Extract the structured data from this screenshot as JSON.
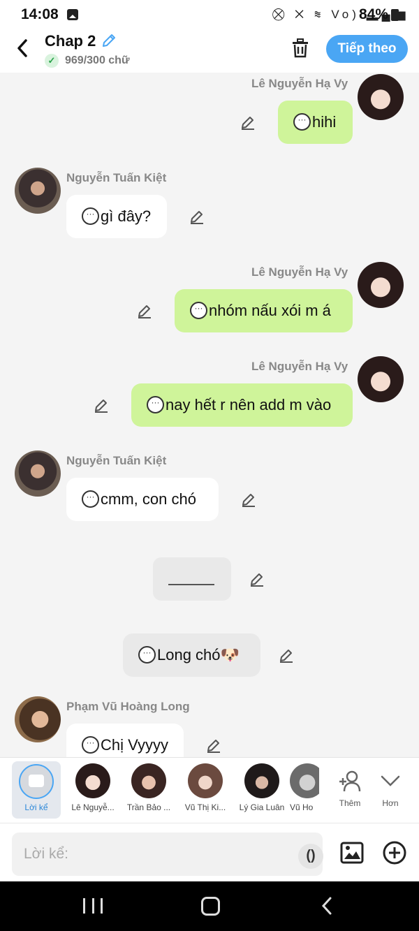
{
  "status_bar": {
    "time": "14:08",
    "network_icons": "⛒ ✕ ≋ Vo) ▂▄▆",
    "battery": "84%"
  },
  "header": {
    "title": "Chap 2",
    "word_count": "969/300 chữ",
    "next_label": "Tiếp theo"
  },
  "messages": [
    {
      "sender": "Lê Nguyễn Hạ Vy",
      "text": "hihi"
    },
    {
      "sender": "Nguyễn Tuấn Kiệt",
      "text": "gì đây?"
    },
    {
      "sender": "Lê Nguyễn Hạ Vy",
      "text": "nhóm nấu xói m á"
    },
    {
      "sender": "Lê Nguyễn Hạ Vy",
      "text": "nay hết r nên add m vào"
    },
    {
      "sender": "Nguyễn Tuấn Kiệt",
      "text": "cmm, con chó"
    },
    {
      "sender": "",
      "text": ""
    },
    {
      "sender": "",
      "text": "Long chó🐶"
    },
    {
      "sender": "Phạm Vũ Hoàng Long",
      "text": "Chị Vyyyy"
    }
  ],
  "tabs": [
    {
      "label": "Lời kể",
      "active": true
    },
    {
      "label": "Lê Nguyễ..."
    },
    {
      "label": "Trần Bảo ..."
    },
    {
      "label": "Vũ Thị Ki..."
    },
    {
      "label": "Lý Gia Luân"
    },
    {
      "label": "Vũ Ho"
    },
    {
      "label": "Thêm"
    },
    {
      "label": "Hơn"
    }
  ],
  "input": {
    "placeholder": "Lời kể:",
    "paren": "()"
  },
  "colors": {
    "accent": "#4aa6f4",
    "bubble_green": "#cff49a",
    "bubble_white": "#ffffff"
  }
}
